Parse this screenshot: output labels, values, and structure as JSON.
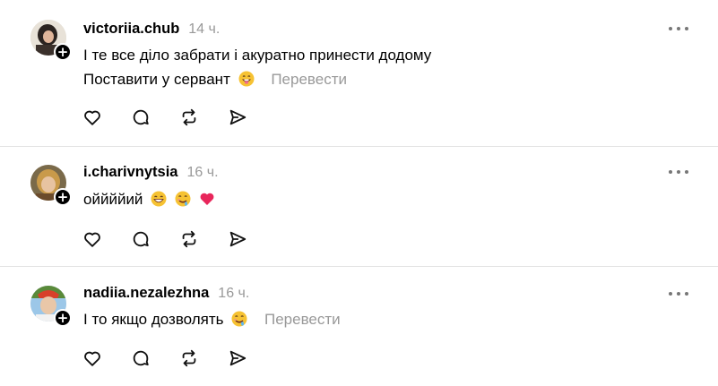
{
  "posts": [
    {
      "username": "victoriia.chub",
      "time": "14 ч.",
      "lines": [
        "І те все діло забрати і акуратно принести додому",
        "Поставити у сервант"
      ],
      "emojis": [
        "grinning-face-with-tongue"
      ],
      "translate": "Перевести",
      "follow": "+"
    },
    {
      "username": "i.charivnytsia",
      "time": "16 ч.",
      "lines": [
        "оййййий"
      ],
      "emojis": [
        "grinning-face-with-smiling-eyes",
        "drooling-face",
        "heart"
      ],
      "translate": "",
      "follow": "+"
    },
    {
      "username": "nadiia.nezalezhna",
      "time": "16 ч.",
      "lines": [
        "І то якщо дозволять"
      ],
      "emojis": [
        "drooling-face"
      ],
      "translate": "Перевести",
      "follow": "+"
    }
  ],
  "colors": {
    "text": "#000000",
    "muted": "#999999",
    "divider": "#e3e3e3",
    "emoji_face": "#f6c233",
    "heart": "#e8265b"
  }
}
